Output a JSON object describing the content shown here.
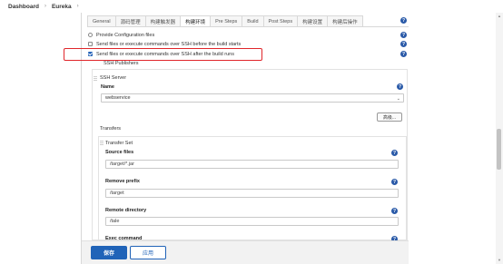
{
  "breadcrumb": {
    "root": "Dashboard",
    "project": "Eureka",
    "sep": "›"
  },
  "tabs": [
    "General",
    "源码管理",
    "构建触发器",
    "构建环境",
    "Pre Steps",
    "Build",
    "Post Steps",
    "构建设置",
    "构建后操作"
  ],
  "options": {
    "provide_config": "Provide Configuration files",
    "ssh_before": "Send files or execute commands over SSH before the build starts",
    "ssh_after": "Send files or execute commands over SSH after the build runs"
  },
  "ssh": {
    "publishers_label": "SSH Publishers",
    "server_label": "SSH Server",
    "name_label": "Name",
    "name_value": "webservice",
    "advanced_label": "高级...",
    "transfers_label": "Transfers",
    "transfer_set_label": "Transfer Set",
    "source_files_label": "Source files",
    "source_files_value": "/target/*.jar",
    "remove_prefix_label": "Remove prefix",
    "remove_prefix_value": "/target",
    "remote_dir_label": "Remote directory",
    "remote_dir_value": "/tale",
    "exec_command_label": "Exec command"
  },
  "buttons": {
    "save": "保存",
    "apply": "应用"
  },
  "help_glyph": "?",
  "chevron_glyph": "⌄",
  "colors": {
    "primary": "#2063b8",
    "highlight": "#e0262b",
    "help": "#2a5aa8"
  }
}
